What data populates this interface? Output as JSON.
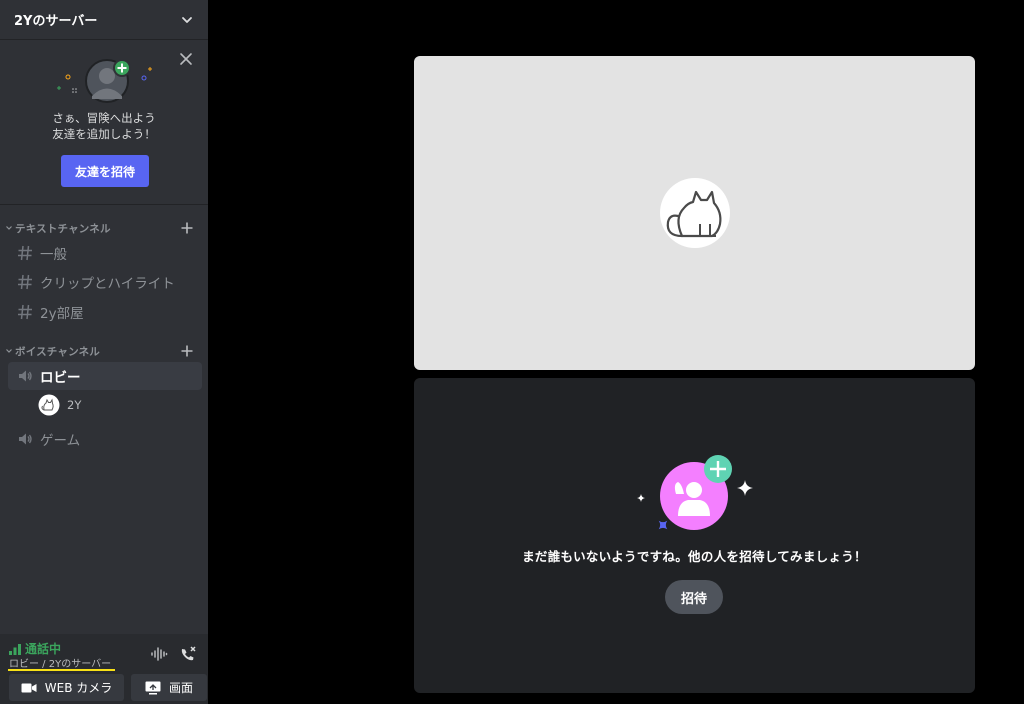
{
  "server": {
    "name": "2Yのサーバー"
  },
  "invite_card": {
    "line1": "さぁ、冒険へ出よう",
    "line2": "友達を追加しよう！",
    "button_label": "友達を招待"
  },
  "text_category": {
    "label": "テキストチャンネル"
  },
  "text_channels": [
    {
      "label": "一般"
    },
    {
      "label": "クリップとハイライト"
    },
    {
      "label": "2y部屋"
    }
  ],
  "voice_category": {
    "label": "ボイスチャンネル"
  },
  "voice_channels": [
    {
      "label": "ロビー",
      "active": true
    },
    {
      "label": "ゲーム",
      "active": false
    }
  ],
  "voice_user": {
    "name": "2Y"
  },
  "voice_panel": {
    "status": "通話中",
    "location": "ロビー / 2Yのサーバー",
    "camera_label": "WEB カメラ",
    "screen_label": "画面"
  },
  "empty_state": {
    "message": "まだ誰もいないようですね。他の人を招待してみましょう！",
    "invite_label": "招待"
  },
  "colors": {
    "accent": "#5865f2",
    "connected_green": "#3ba55d",
    "pink_avatar": "#f47fff",
    "teal_plus": "#5fd3b3"
  }
}
